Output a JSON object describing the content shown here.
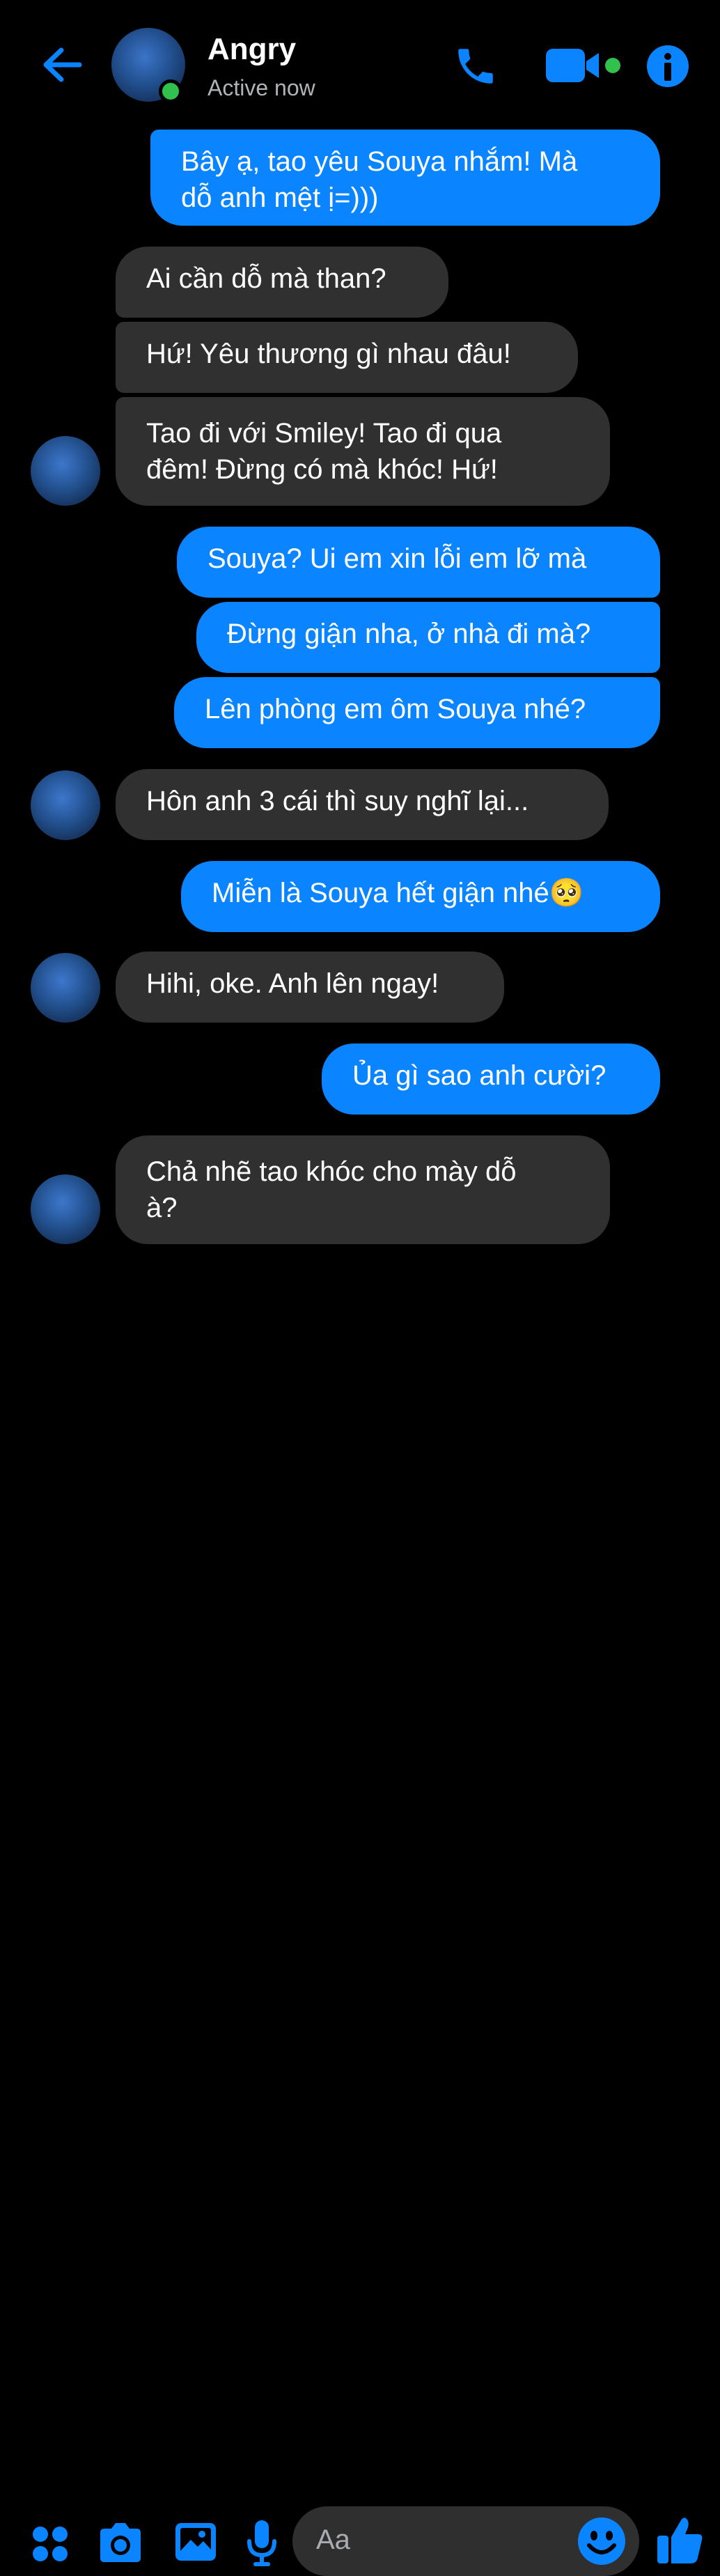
{
  "header": {
    "contact_name": "Angry",
    "status": "Active now"
  },
  "messages": [
    {
      "from": "me",
      "text_lines": [
        "Bây ạ, tao yêu Souya nhắm! Mà",
        "dỗ anh mệt ị=)))"
      ]
    },
    {
      "from": "them",
      "text_lines": [
        "Ai cần dỗ mà than?"
      ]
    },
    {
      "from": "them",
      "text_lines": [
        "Hứ! Yêu thương gì nhau đâu!"
      ]
    },
    {
      "from": "them",
      "text_lines": [
        "Tao đi với Smiley! Tao đi qua",
        "đêm! Đừng có mà khóc! Hứ!"
      ]
    },
    {
      "from": "me",
      "text_lines": [
        "Souya? Ui em xin lỗi em lỡ mà"
      ]
    },
    {
      "from": "me",
      "text_lines": [
        "Đừng giận nha, ở nhà đi mà?"
      ]
    },
    {
      "from": "me",
      "text_lines": [
        "Lên phòng em ôm Souya nhé?"
      ]
    },
    {
      "from": "them",
      "text_lines": [
        "Hôn anh 3 cái thì suy nghĩ lại..."
      ]
    },
    {
      "from": "me",
      "text_lines": [
        "Miễn là Souya hết giận nhé🥺"
      ]
    },
    {
      "from": "them",
      "text_lines": [
        "Hihi, oke. Anh lên ngay!"
      ]
    },
    {
      "from": "me",
      "text_lines": [
        "Ủa gì sao anh cười?"
      ]
    },
    {
      "from": "them",
      "text_lines": [
        "Chả nhẽ tao khóc cho mày dỗ",
        "à?"
      ]
    }
  ],
  "composer": {
    "placeholder": "Aa"
  },
  "colors": {
    "accent": "#0b84ff",
    "outgoing_bubble": "#0b84ff",
    "incoming_bubble": "#303030",
    "online": "#31c24d",
    "background": "#000000"
  },
  "icons": [
    "back-arrow-icon",
    "phone-icon",
    "video-camera-icon",
    "info-icon",
    "apps-icon",
    "camera-icon",
    "image-icon",
    "microphone-icon",
    "emoji-icon",
    "thumbs-up-icon"
  ]
}
